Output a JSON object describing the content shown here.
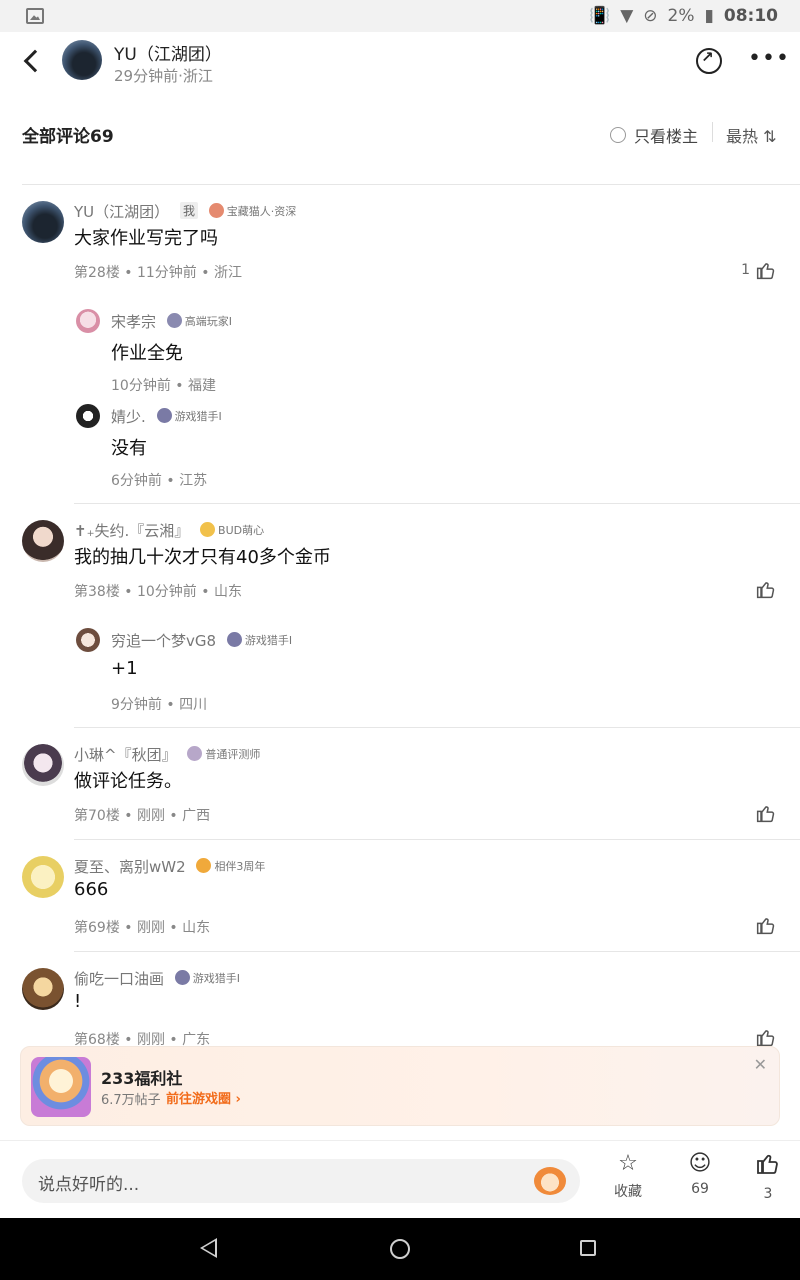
{
  "status_bar": {
    "battery": "2%",
    "time": "08:10"
  },
  "header": {
    "name": "YU（江湖团）",
    "sub": "29分钟前·浙江"
  },
  "section": {
    "title": "全部评论69",
    "owner_only": "只看楼主",
    "sort": "最热 ⇅"
  },
  "comments": [
    {
      "name": "YU（江湖团）",
      "me_tag": "我",
      "badge": "宝藏猫人·资深",
      "text": "大家作业写完了吗",
      "meta": "第28楼 • 11分钟前 • 浙江",
      "likes": "1",
      "replies": [
        {
          "name": "宋孝宗",
          "badge": "高端玩家I",
          "text": "作业全免",
          "meta": "10分钟前 • 福建"
        },
        {
          "name": "婧少.",
          "badge": "游戏猎手I",
          "text": "没有",
          "meta": "6分钟前 • 江苏"
        }
      ]
    },
    {
      "name": "✝₊失约.『云湘』",
      "badge": "BUD萌心",
      "text": "我的抽几十次才只有40多个金币",
      "meta": "第38楼 • 10分钟前 • 山东",
      "likes": "",
      "replies": [
        {
          "name": "穷追一个梦vG8",
          "badge": "游戏猎手I",
          "text": "+1",
          "meta": "9分钟前 • 四川"
        }
      ]
    },
    {
      "name": "小琳^『秋团』",
      "badge": "普通评测师",
      "text": "做评论任务。",
      "meta": "第70楼 • 刚刚 • 广西",
      "likes": ""
    },
    {
      "name": "夏至、离别wW2",
      "badge": "相伴3周年",
      "text": "666",
      "meta": "第69楼 • 刚刚 • 山东",
      "likes": ""
    },
    {
      "name": "偷吃一口油画",
      "badge": "游戏猎手I",
      "text": "!",
      "meta": "第68楼 • 刚刚 • 广东",
      "likes": ""
    }
  ],
  "promo": {
    "title": "233福利社",
    "count": "6.7万帖子",
    "link": "前往游戏圈 ›"
  },
  "bottom": {
    "placeholder": "说点好听的...",
    "favorite": "收藏",
    "comments": "69",
    "likes": "3"
  }
}
